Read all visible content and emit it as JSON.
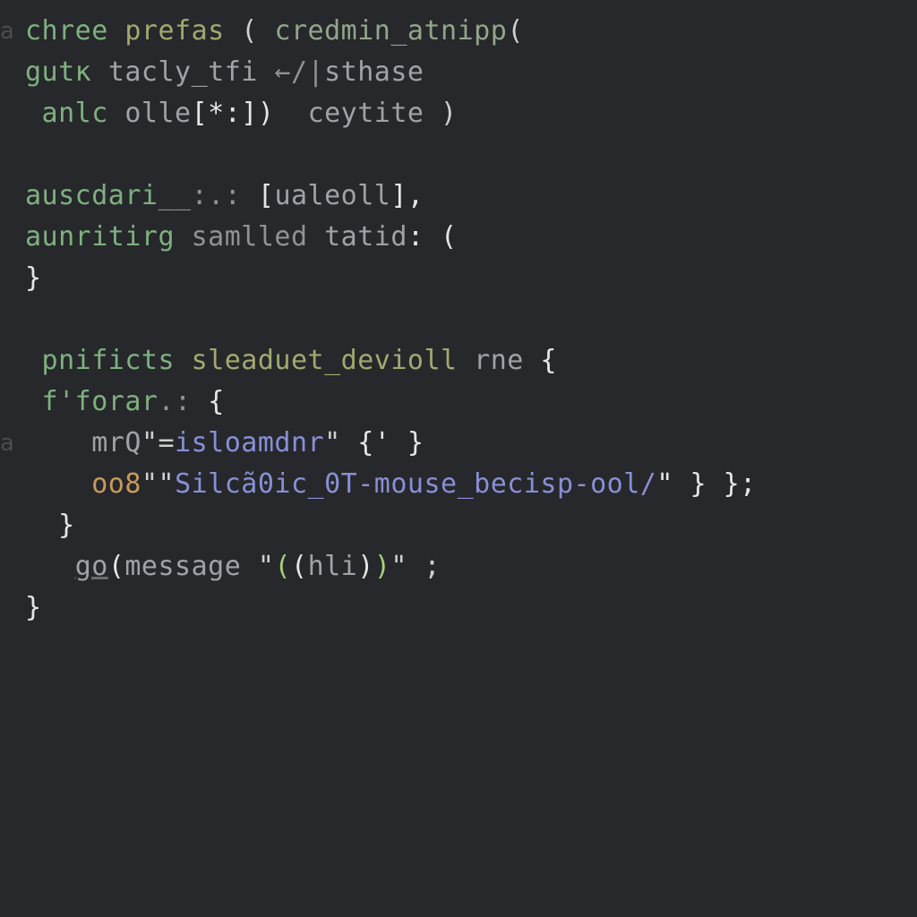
{
  "gutter": [
    "a",
    "",
    "",
    "",
    "",
    "",
    "",
    "",
    "",
    "",
    "a",
    "",
    "",
    "",
    "",
    "",
    "",
    ""
  ],
  "lines": [
    {
      "tokens": [
        {
          "t": "chree",
          "cls": "c-green"
        },
        {
          "t": " ",
          "cls": ""
        },
        {
          "t": "prefas",
          "cls": "c-olive"
        },
        {
          "t": " ( ",
          "cls": "c-punc"
        },
        {
          "t": "credmin_atnipp",
          "cls": "c-sage"
        },
        {
          "t": "(",
          "cls": "c-punc"
        }
      ]
    },
    {
      "tokens": [
        {
          "t": "gutк",
          "cls": "c-green"
        },
        {
          "t": " ",
          "cls": ""
        },
        {
          "t": "tacly_tfi",
          "cls": "c-ident"
        },
        {
          "t": " ",
          "cls": ""
        },
        {
          "t": "←/|",
          "cls": "c-dim"
        },
        {
          "t": "sthase",
          "cls": "c-ident"
        }
      ]
    },
    {
      "tokens": [
        {
          "t": " anlc",
          "cls": "c-green"
        },
        {
          "t": " ",
          "cls": ""
        },
        {
          "t": "olle",
          "cls": "c-ident"
        },
        {
          "t": "[*:])",
          "cls": "c-white"
        },
        {
          "t": "  ",
          "cls": ""
        },
        {
          "t": "ceytite",
          "cls": "c-ident"
        },
        {
          "t": " )",
          "cls": "c-punc"
        }
      ]
    },
    {
      "tokens": [
        {
          "t": "",
          "cls": ""
        }
      ]
    },
    {
      "tokens": [
        {
          "t": "auscdari",
          "cls": "c-green"
        },
        {
          "t": "__:.: ",
          "cls": "c-dim"
        },
        {
          "t": "[",
          "cls": "c-white"
        },
        {
          "t": "ualeoll",
          "cls": "c-ident"
        },
        {
          "t": "],",
          "cls": "c-white"
        }
      ]
    },
    {
      "tokens": [
        {
          "t": "aunritirg",
          "cls": "c-green"
        },
        {
          "t": " ",
          "cls": ""
        },
        {
          "t": "samlled",
          "cls": "c-dim"
        },
        {
          "t": " ",
          "cls": ""
        },
        {
          "t": "tatid",
          "cls": "c-ident"
        },
        {
          "t": ": (",
          "cls": "c-white"
        }
      ]
    },
    {
      "tokens": [
        {
          "t": "}",
          "cls": "c-white"
        }
      ]
    },
    {
      "tokens": [
        {
          "t": "",
          "cls": ""
        }
      ]
    },
    {
      "tokens": [
        {
          "t": " pnificts",
          "cls": "c-green"
        },
        {
          "t": " ",
          "cls": ""
        },
        {
          "t": "sleaduet_devioll",
          "cls": "c-olive"
        },
        {
          "t": " ",
          "cls": ""
        },
        {
          "t": "rne",
          "cls": "c-ident"
        },
        {
          "t": " {",
          "cls": "c-white"
        }
      ]
    },
    {
      "tokens": [
        {
          "t": " f'forar",
          "cls": "c-green"
        },
        {
          "t": ".: ",
          "cls": "c-dim"
        },
        {
          "t": "{",
          "cls": "c-white"
        }
      ]
    },
    {
      "tokens": [
        {
          "t": "    mrQ",
          "cls": "c-ident"
        },
        {
          "t": "\"=",
          "cls": "c-punc"
        },
        {
          "t": "isloamdnr",
          "cls": "c-blue"
        },
        {
          "t": "\" ",
          "cls": "c-punc"
        },
        {
          "t": "{' }",
          "cls": "c-white"
        }
      ]
    },
    {
      "tokens": [
        {
          "t": "    oo8",
          "cls": "c-orange"
        },
        {
          "t": "\"",
          "cls": "c-punc"
        },
        {
          "t": "\"",
          "cls": "c-punc"
        },
        {
          "t": "Silcã0ic_0T-mouse_becisp-ool/",
          "cls": "c-blue"
        },
        {
          "t": "\" } };",
          "cls": "c-white"
        }
      ]
    },
    {
      "tokens": [
        {
          "t": "  }",
          "cls": "c-white"
        }
      ]
    },
    {
      "tokens": [
        {
          "t": "   ",
          "cls": ""
        },
        {
          "t": "go",
          "cls": "c-ident u"
        },
        {
          "t": "(",
          "cls": "c-white"
        },
        {
          "t": "message",
          "cls": "c-ident"
        },
        {
          "t": " ",
          "cls": ""
        },
        {
          "t": "\"",
          "cls": "c-punc"
        },
        {
          "t": "(",
          "cls": "c-lime"
        },
        {
          "t": "(",
          "cls": "c-white"
        },
        {
          "t": "hli",
          "cls": "c-ident"
        },
        {
          "t": ")",
          "cls": "c-white"
        },
        {
          "t": ")",
          "cls": "c-lime"
        },
        {
          "t": "\" ;",
          "cls": "c-punc"
        }
      ]
    },
    {
      "tokens": [
        {
          "t": "}",
          "cls": "c-white"
        }
      ]
    }
  ]
}
